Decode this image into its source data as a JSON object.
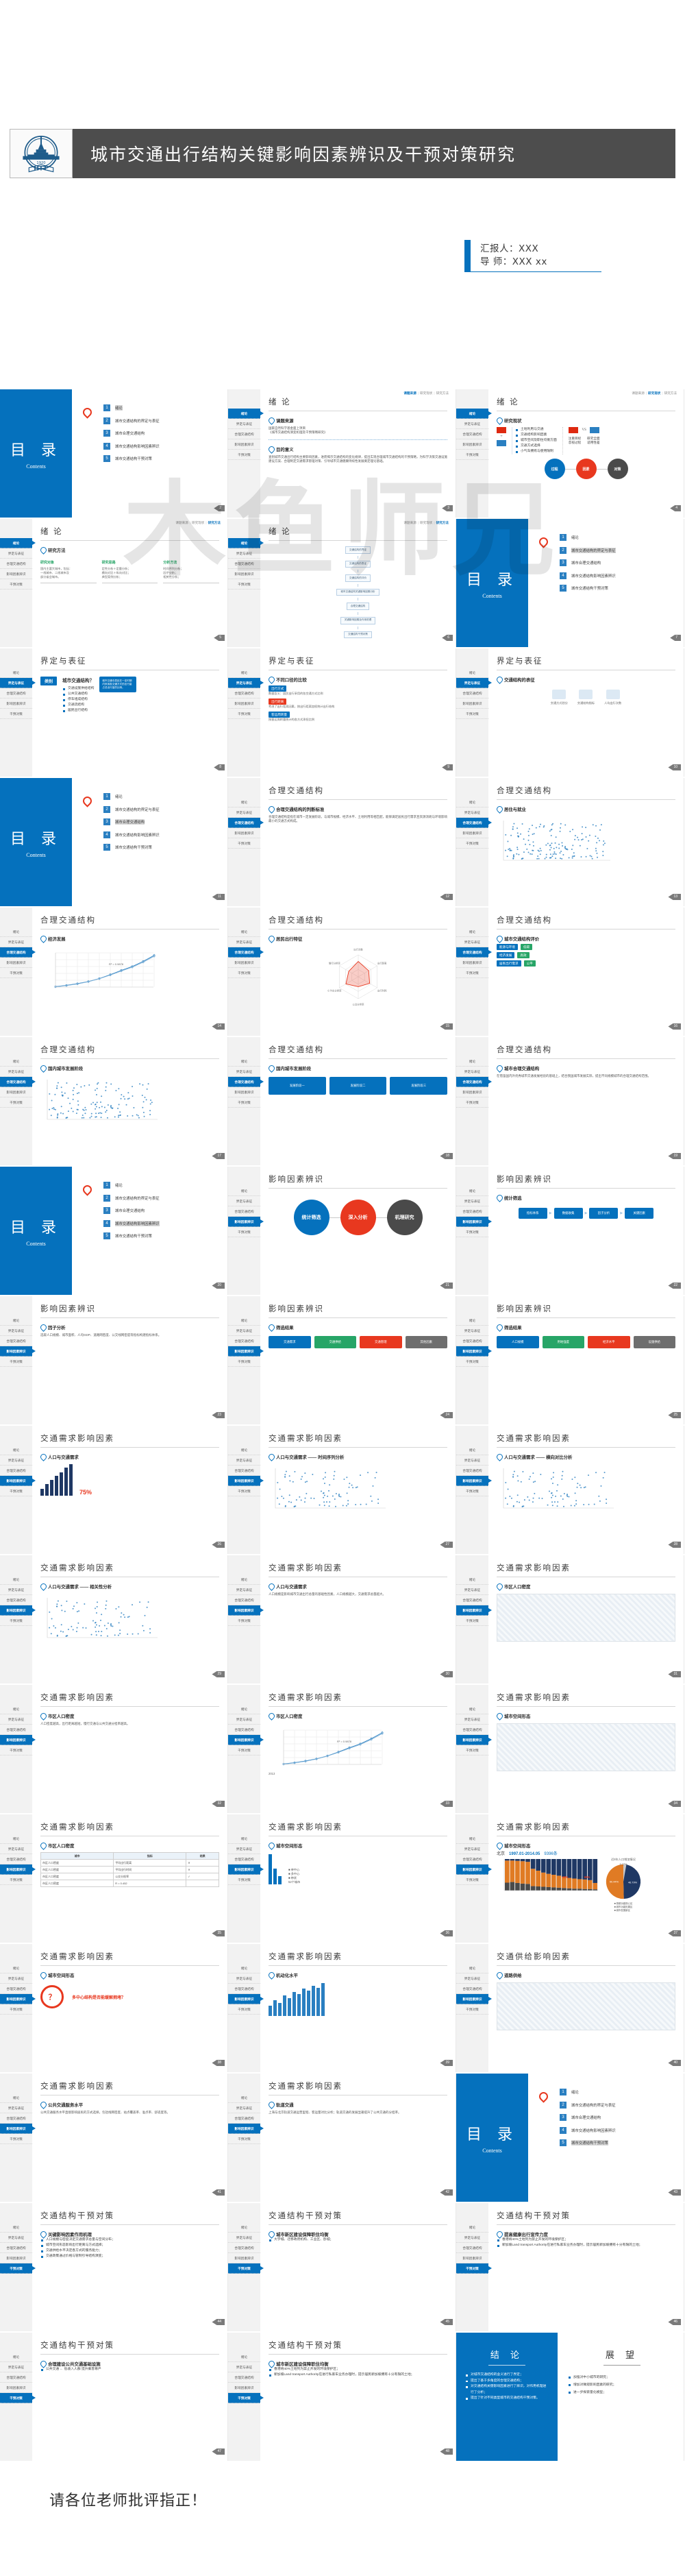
{
  "header": {
    "title": "城市交通出行结构关键影响因素辨识及干预对策研究",
    "logo_name": "hit-university-logo",
    "logo_year": "1920",
    "logo_abbr": "HIT"
  },
  "presenter": {
    "reporter": "汇报人：XXX",
    "advisor": "导 师：XXX xx"
  },
  "watermark": {
    "text": "木鱼师兄"
  },
  "closing": {
    "text": "请各位老师批评指正！"
  },
  "nav": {
    "items": [
      "绪论",
      "界定与表征",
      "合理交通结构",
      "影响因素辨识",
      "干预对策"
    ]
  },
  "toc": {
    "title": "目 录",
    "subtitle": "Contents",
    "items": [
      {
        "num": "1",
        "label": "绪论"
      },
      {
        "num": "2",
        "label": "城市交通结构的界定与表征"
      },
      {
        "num": "3",
        "label": "城市合理交通结构"
      },
      {
        "num": "4",
        "label": "城市交通结构影响因素辨识"
      },
      {
        "num": "5",
        "label": "城市交通结构干预对策"
      }
    ]
  },
  "tabs": {
    "intro": [
      "课题来源",
      "研究现状",
      "研究方法"
    ]
  },
  "slides": [
    {
      "n": 2,
      "kind": "toc",
      "active": 0
    },
    {
      "n": 3,
      "kind": "intro",
      "title": "绪 论",
      "active_tab": 0,
      "active_nav": 0,
      "h1": "课题来源",
      "b1": "国家自然科学基金面上项目\n《城市交通结构演变机理及干预策略研究》",
      "h2": "目的意义",
      "b2": "查别城市交通出行结构主要影响因素，进而揭示交通结构的变化规律，提出实现合理城市交通结构的干预策略，为科学决策交通设施建设方案、合理制定交通需求管理对策、引导城市交通健康持续性发展奠定理论基础。"
    },
    {
      "n": 4,
      "kind": "status",
      "title": "绪 论",
      "active_tab": 1,
      "active_nav": 0,
      "h1": "研究现状",
      "bullets": [
        "土地利用与交通",
        "交通结构影响因素",
        "城市空间及职住均衡方面",
        "交通方式选择",
        "小气车拥有与使用限制"
      ],
      "vs_left": [
        "注重目标",
        "忽视过程"
      ],
      "vs_right": [
        "研究全面",
        "适用性差"
      ],
      "vs_label": "VS",
      "circles": [
        {
          "label": "过程",
          "color": "#0571bd"
        },
        {
          "label": "因素",
          "color": "#e8381f"
        },
        {
          "label": "对策",
          "color": "#4a4a4a"
        }
      ]
    },
    {
      "n": 5,
      "kind": "method",
      "title": "绪 论",
      "active_tab": 2,
      "active_nav": 0,
      "h1": "研究方法",
      "cols": [
        {
          "h": "研究对象",
          "b": "国内主要大城市，包括：\n一线城市、二线城市及\n部分省会城市。"
        },
        {
          "h": "研究思路",
          "b": "定性分析＋定量分析；\n横向对比＋纵向对比；\n典型案例分析；"
        },
        {
          "h": "分析方法",
          "b": "时间序列分析；\n因子分析；\n相关性分析；"
        }
      ]
    },
    {
      "n": 6,
      "kind": "flow",
      "title": "绪 论",
      "active_tab": 2,
      "active_nav": 0,
      "nodes": [
        "交通结构的界定",
        "交通结构的表征",
        "交通结构的评价",
        "城市交通结构关键影响因素分析",
        "合理交通结构",
        "关键影响因素及作用机理",
        "交通结构干预对策"
      ]
    },
    {
      "n": 7,
      "kind": "toc",
      "active": 1
    },
    {
      "n": 8,
      "kind": "define",
      "title": "界定与表征",
      "active_nav": 1,
      "chip": "类别",
      "q": "城市交通结构？",
      "list": [
        "交通设施供给结构",
        "公共交通结构",
        "停车组成结构",
        "交通流结构",
        "居民出行结构"
      ],
      "note": "城市交通中居民在一定时期内采用各交通方式的出行量占总出行量的比例。"
    },
    {
      "n": 9,
      "kind": "define2",
      "title": "界定与表征",
      "active_nav": 1,
      "h1": "不同口径的比较",
      "rows": [
        {
          "t": "出行方式",
          "b": "数据含义：居民出行采用的各交通方式比例"
        },
        {
          "t": "出行距离",
          "b": "考虑了出行距离因素，按出行距离加权统计出行结构"
        },
        {
          "t": "客运周转量",
          "b": "按客运周转量统计的各方式承担比例"
        }
      ]
    },
    {
      "n": 10,
      "kind": "define3",
      "title": "界定与表征",
      "active_nav": 1,
      "h1": "交通结构的表征",
      "items": [
        "交通方式划分",
        "交通结构指标",
        "人均出行次数"
      ]
    },
    {
      "n": 11,
      "kind": "toc",
      "active": 2
    },
    {
      "n": 12,
      "kind": "rational1",
      "title": "合理交通结构",
      "active_nav": 2,
      "h1": "合理交通结构的判断标准",
      "body": "合理交通结构是指在城市一定发展阶段，与城市规模、经济水平、土地利用等相匹配，能够满足居民出行需求且资源消耗与环境影响最小的交通方式构成。"
    },
    {
      "n": 13,
      "kind": "rational2",
      "title": "合理交通结构",
      "active_nav": 2,
      "h1": "居住与就业",
      "chart_ref": "scatter-network"
    },
    {
      "n": 14,
      "kind": "chart-line",
      "title": "合理交通结构",
      "active_nav": 2,
      "h1": "经济发展",
      "note": "R² = 0.9878"
    },
    {
      "n": 15,
      "kind": "radar",
      "title": "合理交通结构",
      "active_nav": 2,
      "h1": "居民出行特征"
    },
    {
      "n": 16,
      "kind": "rational3",
      "title": "合理交通结构",
      "active_nav": 2,
      "h1": "城市交通结构评价",
      "chips": [
        "能源与环境",
        "经济发展",
        "居民出行需求"
      ],
      "tags": [
        "低碳",
        "高效",
        "公平"
      ]
    },
    {
      "n": 17,
      "kind": "chart-scatter",
      "title": "合理交通结构",
      "active_nav": 2,
      "h1": "国内城市发展阶段"
    },
    {
      "n": 18,
      "kind": "rational4",
      "title": "合理交通结构",
      "active_nav": 2,
      "h1": "国内城市发展阶段",
      "boxes": [
        "发展阶段一",
        "发展阶段二",
        "发展阶段三"
      ]
    },
    {
      "n": 19,
      "kind": "rational5",
      "title": "合理交通结构",
      "active_nav": 2,
      "h1": "城市合理交通结构",
      "body": "在借鉴国内外优秀城市交通发展经验的基础上，结合我国城市发展实际，提出不同规模城市的合理交通结构范围。"
    },
    {
      "n": 20,
      "kind": "toc",
      "active": 3
    },
    {
      "n": 21,
      "kind": "circles",
      "title": "影响因素辨识",
      "active_nav": 3,
      "circles": [
        {
          "label": "统计筛选",
          "color": "#0571bd"
        },
        {
          "label": "深入分析",
          "color": "#e8381f"
        },
        {
          "label": "机理研究",
          "color": "#4a4a4a"
        }
      ]
    },
    {
      "n": 22,
      "kind": "factor1",
      "title": "影响因素辨识",
      "active_nav": 3,
      "h1": "统计筛选",
      "flow": [
        "指标体系",
        "数据收集",
        "因子分析",
        "关键因素"
      ]
    },
    {
      "n": 23,
      "kind": "factor2",
      "title": "影响因素辨识",
      "active_nav": 3,
      "h1": "因子分析",
      "body": "选取人口规模、城市面积、人均GDP、道路网密度、公交线网密度等指标构建指标体系。"
    },
    {
      "n": 24,
      "kind": "factor3",
      "title": "影响因素辨识",
      "active_nav": 3,
      "h1": "筛选结果",
      "groups": [
        "交通需求",
        "交通供给",
        "交通管理",
        "其他因素"
      ]
    },
    {
      "n": 25,
      "kind": "factor4",
      "title": "影响因素辨识",
      "active_nav": 3,
      "h1": "筛选结果",
      "groups": [
        "人口规模",
        "用地强度",
        "经济水平",
        "设施供给"
      ]
    },
    {
      "n": 26,
      "kind": "bar3d",
      "title": "交通需求影响因素",
      "active_nav": 3,
      "h1": "人口与交通需求",
      "note": "75%"
    },
    {
      "n": 27,
      "kind": "chart-scatter2",
      "title": "交通需求影响因素",
      "active_nav": 3,
      "h1": "人口与交通需求 —— 时间序列分析"
    },
    {
      "n": 28,
      "kind": "chart-scatter3",
      "title": "交通需求影响因素",
      "active_nav": 3,
      "h1": "人口与交通需求 —— 横向对比分析"
    },
    {
      "n": 29,
      "kind": "chart-scatter4",
      "title": "交通需求影响因素",
      "active_nav": 3,
      "h1": "人口与交通需求 —— 相关性分析"
    },
    {
      "n": 30,
      "kind": "factor5",
      "title": "交通需求影响因素",
      "active_nav": 3,
      "h1": "人口与交通需求",
      "body": "人口规模是影响城市交通出行总量的基础性因素，人口规模越大，交通需求总量越大。"
    },
    {
      "n": 31,
      "kind": "map",
      "title": "交通需求影响因素",
      "active_nav": 3,
      "h1": "市区人口密度"
    },
    {
      "n": 32,
      "kind": "factor6",
      "title": "交通需求影响因素",
      "active_nav": 3,
      "h1": "市区人口密度",
      "body": "人口密度越高，出行距离越短，慢行交通与公共交通分担率越高。"
    },
    {
      "n": 33,
      "kind": "chart-line2",
      "title": "交通需求影响因素",
      "active_nav": 3,
      "h1": "市区人口密度",
      "note": "2013"
    },
    {
      "n": 34,
      "kind": "map2",
      "title": "交通需求影响因素",
      "active_nav": 3,
      "h1": "城市空间形态"
    },
    {
      "n": 35,
      "kind": "table",
      "title": "交通需求影响因素",
      "active_nav": 3,
      "h1": "市区人口密度",
      "head": [
        "城市",
        "指标",
        "结果"
      ],
      "rows": [
        [
          "市区人口密度",
          "平均出行距离",
          "✕"
        ],
        [
          "市区人口密度",
          "平均出行时间",
          "✕"
        ],
        [
          "市区人口密度",
          "公交分担率",
          "✓"
        ],
        [
          "市区人口密度",
          "R = 0.452",
          ""
        ]
      ]
    },
    {
      "n": 36,
      "kind": "bars-city",
      "title": "交通需求影响因素",
      "active_nav": 3,
      "h1": "城市空间形态",
      "legend": [
        "单中心",
        "多中心",
        "带状"
      ],
      "note": "52个城市"
    },
    {
      "n": 37,
      "kind": "stacked",
      "title": "交通需求影响因素",
      "active_nav": 3,
      "h1": "城市空间形态",
      "city": "北京",
      "period": "1997.01-2014.05",
      "count": "9396条",
      "marks": [
        "58%",
        "65%"
      ],
      "pie_title": "近8年人口增加情况",
      "pie": [
        {
          "label": "首都功能核心区",
          "value": 2.77
        },
        {
          "label": "城市功能拓展区",
          "value": 46.79
        },
        {
          "label": "城市发展新区",
          "value": 50.44
        }
      ]
    },
    {
      "n": 38,
      "kind": "circlehl",
      "title": "交通需求影响因素",
      "active_nav": 3,
      "h1": "城市空间形态",
      "ring_text": "？",
      "question": "多中心结构是否能缓解拥堵？"
    },
    {
      "n": 39,
      "kind": "bars2",
      "title": "交通需求影响因素",
      "active_nav": 3,
      "h1": "机动化水平"
    },
    {
      "n": 40,
      "kind": "map3",
      "title": "交通供给影响因素",
      "active_nav": 3,
      "h1": "道路供给"
    },
    {
      "n": 41,
      "kind": "supply1",
      "title": "交通需求影响因素",
      "active_nav": 3,
      "h1": "公共交通服务水平",
      "body": "公共交通服务水平直接影响居民的方式选择，包括线网密度、站点覆盖率、准点率、舒适度等。"
    },
    {
      "n": 42,
      "kind": "supply2",
      "title": "交通需求影响因素",
      "active_nav": 3,
      "h1": "轨道交通",
      "body": "上海与北京轨道交通运营里程、客运量对比分析；轨道交通的发展显著提升了公共交通的分担率。"
    },
    {
      "n": 43,
      "kind": "toc",
      "active": 4
    },
    {
      "n": 44,
      "kind": "policy0",
      "title": "交通结构干预对策",
      "active_nav": 4,
      "h1": "关键影响因素作用机理",
      "bullets": [
        "人口规模与密度决定交通需求总量与空间分布；",
        "城市空间形态影响出行距离与方式选择；",
        "交通供给水平决定各方式的服务能力；",
        "交通政策通过价格与管制引导结构演变；"
      ]
    },
    {
      "n": 45,
      "kind": "policy1",
      "title": "交通结构干预对策",
      "active_nav": 4,
      "h1": "城市新区建设保障职住均衡",
      "bullets": [
        "大学城、迁移政府机构、工业区、卧城；"
      ]
    },
    {
      "n": 46,
      "kind": "policy2",
      "title": "交通结构干预对策",
      "active_nav": 4,
      "h1": "提高健康出行宣传力度",
      "bullets": [
        "香港将40%土地列为禁止开发的环境保护区；",
        "新加坡Land transport Authority在进行私家车业务办理时，提示居民新加坡拥有十分有限的土地；"
      ]
    },
    {
      "n": 47,
      "kind": "policy3",
      "title": "交通结构干预对策",
      "active_nav": 4,
      "h1": "合理建设公共交通基础设施",
      "bullets": [
        "公共交通 ← 低收入人群    提升乘客尊严"
      ]
    },
    {
      "n": 48,
      "kind": "policy4",
      "title": "交通结构干预对策",
      "active_nav": 4,
      "h1": "城市新区建设保障职住均衡",
      "bullets": [
        "香港将40%土地列为禁止开发的环境保护区；",
        "新加坡Land transport Authority在进行私家车业务办理时，提示居民新加坡拥有十分有限的土地；"
      ]
    },
    {
      "n": 49,
      "kind": "conclusion",
      "left_title": "结 论",
      "left_items": [
        "对城市交通结构的含义进行了界定；",
        "提出了基于多角度的合理交通结构；",
        "对交通结构关键影响因素进行了辨识，对作用机理进行了分析；",
        "提出了针对不同类型城市的交通结构干预对策。"
      ],
      "right_title": "展 望",
      "right_items": [
        "加强对中小城市的研究；",
        "增加对微观影响因素的研究；",
        "进一步探索量化模型；"
      ]
    }
  ],
  "chart_data": [
    {
      "type": "line",
      "title": "经济发展",
      "xlabel": "年份",
      "ylabel": "人均GDP（美元）",
      "x": [
        1995,
        1997,
        1999,
        2001,
        2003,
        2005,
        2007,
        2009,
        2011,
        2013
      ],
      "series": [
        {
          "name": "实际值",
          "values": [
            420,
            480,
            560,
            660,
            800,
            980,
            1180,
            1360,
            1600,
            1880
          ]
        },
        {
          "name": "拟合值",
          "values": [
            410,
            470,
            545,
            650,
            790,
            960,
            1150,
            1330,
            1560,
            1840
          ]
        }
      ],
      "annotation": "R² = 0.9878",
      "ylim": [
        400,
        2000
      ],
      "grid": true
    },
    {
      "type": "bar",
      "title": "城市空间形态 / 52个城市",
      "categories": [
        "单中心",
        "多中心",
        "带状"
      ],
      "values": [
        29,
        15,
        8
      ],
      "ylabel": "城市数量",
      "legend": "right"
    },
    {
      "type": "pie",
      "title": "近8年人口增加情况",
      "labels": [
        "首都功能核心区",
        "城市功能拓展区",
        "城市发展新区"
      ],
      "values": [
        2.77,
        46.79,
        50.44
      ],
      "colors": [
        "#c8c8c8",
        "#1f3864",
        "#e07b24"
      ]
    },
    {
      "type": "bar",
      "title": "北京 1997.01-2014.05 9396条",
      "categories": [
        "1997",
        "1998",
        "1999",
        "2000",
        "2001",
        "2002",
        "2003",
        "2004",
        "2005",
        "2006",
        "2007",
        "2008",
        "2009",
        "2010",
        "2011",
        "2012",
        "2013",
        "2014"
      ],
      "series": [
        {
          "name": "核心区",
          "values": [
            25,
            27,
            24,
            22,
            21,
            14,
            13,
            12,
            11,
            10,
            9,
            8,
            7,
            6,
            6,
            5,
            5,
            4
          ]
        },
        {
          "name": "拓展区",
          "values": [
            70,
            68,
            70,
            71,
            70,
            55,
            50,
            45,
            42,
            40,
            38,
            35,
            33,
            32,
            30,
            30,
            28,
            20
          ]
        },
        {
          "name": "新区",
          "values": [
            5,
            5,
            6,
            7,
            9,
            31,
            37,
            43,
            47,
            50,
            53,
            57,
            60,
            62,
            64,
            65,
            67,
            76
          ]
        }
      ],
      "ylabel": "比例",
      "ylim": [
        0,
        100
      ],
      "annotations": [
        "58%",
        "65%"
      ]
    },
    {
      "type": "radar",
      "title": "居民出行特征",
      "axes": [
        "出行次数",
        "出行距离",
        "出行时耗",
        "公交分担率",
        "小汽车分担率",
        "慢行分担率"
      ],
      "values": [
        0.7,
        0.55,
        0.6,
        0.45,
        0.65,
        0.5
      ]
    },
    {
      "type": "scatter",
      "title": "国内城市发展阶段",
      "xlabel": "人均GDP",
      "ylabel": "机动化水平",
      "n_points": 120
    }
  ]
}
